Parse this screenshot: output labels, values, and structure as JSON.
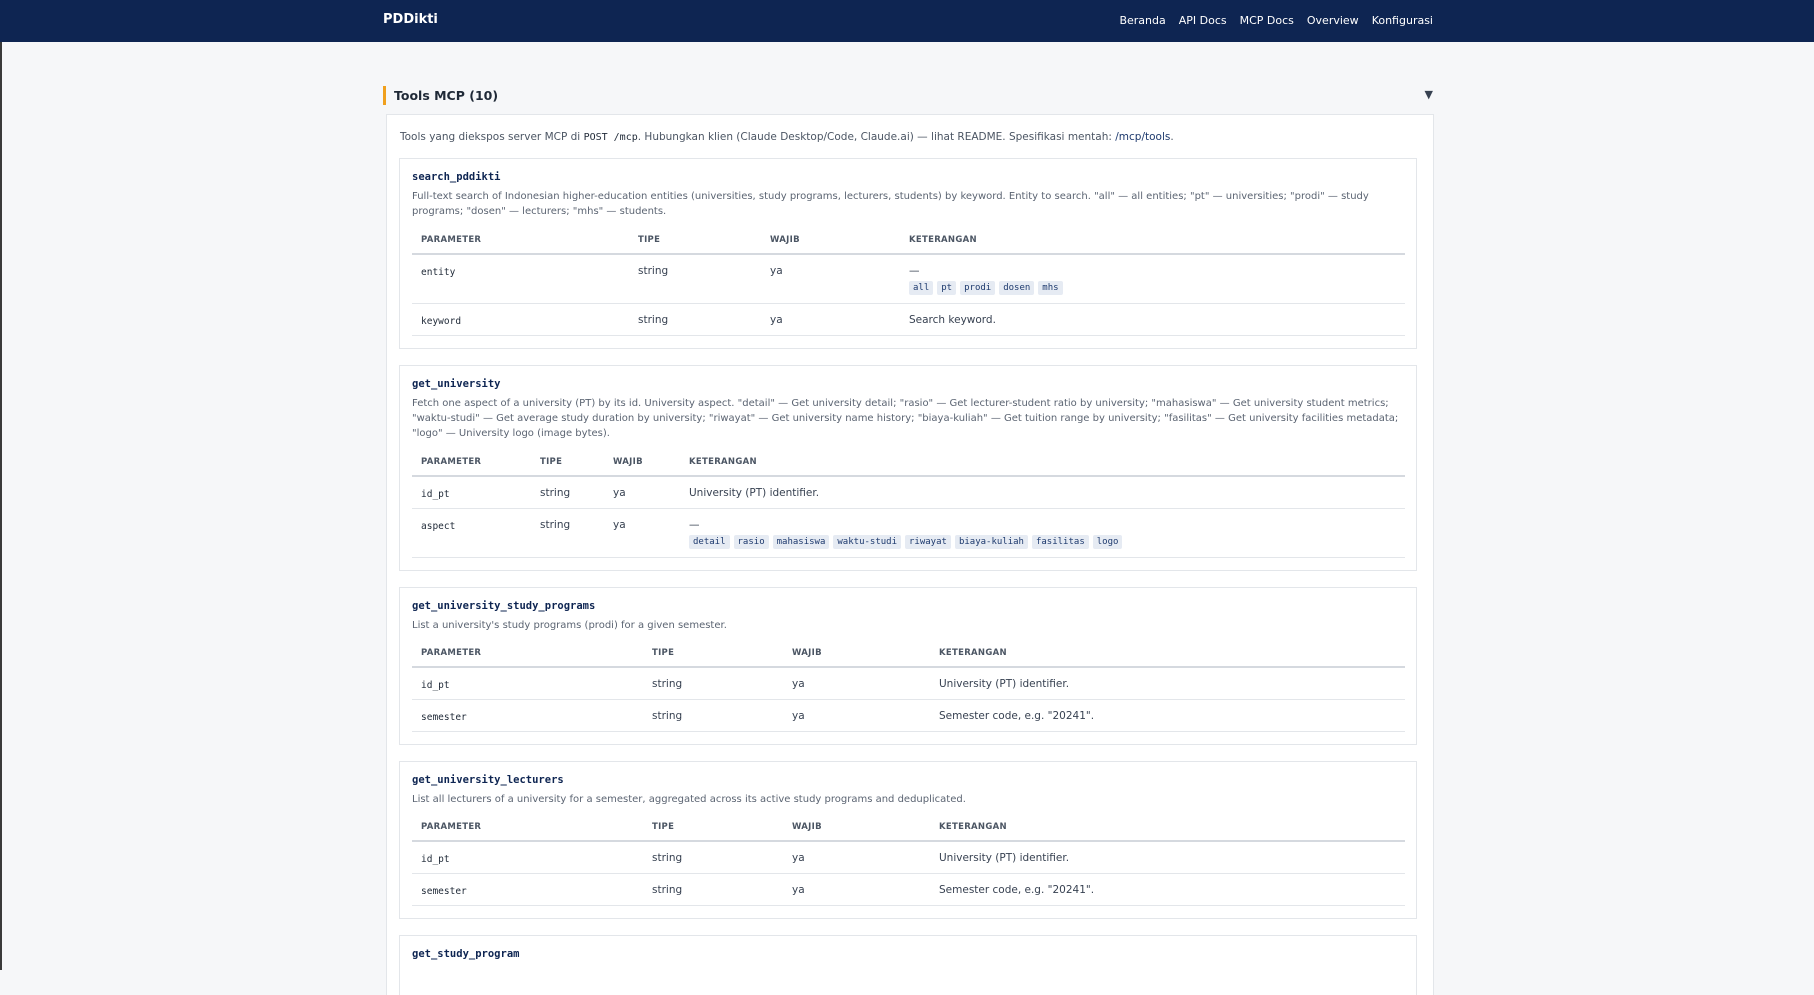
{
  "nav": {
    "brand": "PDDikti",
    "links": [
      "Beranda",
      "API Docs",
      "MCP Docs",
      "Overview",
      "Konfigurasi"
    ]
  },
  "section": {
    "title": "Tools MCP (10)",
    "caret": "▼",
    "intro_prefix": "Tools yang diekspos server MCP di ",
    "intro_code": "POST /mcp",
    "intro_middle": ". Hubungkan klien (Claude Desktop/Code, Claude.ai) — lihat README. Spesifikasi mentah: ",
    "intro_link": "/mcp/tools",
    "intro_suffix": "."
  },
  "table_headers": {
    "parameter": "PARAMETER",
    "type": "TIPE",
    "required": "WAJIB",
    "description": "KETERANGAN"
  },
  "tools": [
    {
      "name": "search_pddikti",
      "description": "Full-text search of Indonesian higher-education entities (universities, study programs, lecturers, students) by keyword. Entity to search. \"all\" — all entities; \"pt\" — universities; \"prodi\" — study programs; \"dosen\" — lecturers; \"mhs\" — students.",
      "params": [
        {
          "name": "entity",
          "type": "string",
          "required": "ya",
          "desc": "—",
          "enum": [
            "all",
            "pt",
            "prodi",
            "dosen",
            "mhs"
          ]
        },
        {
          "name": "keyword",
          "type": "string",
          "required": "ya",
          "desc": "Search keyword."
        }
      ]
    },
    {
      "name": "get_university",
      "description": "Fetch one aspect of a university (PT) by its id. University aspect. \"detail\" — Get university detail; \"rasio\" — Get lecturer-student ratio by university; \"mahasiswa\" — Get university student metrics; \"waktu-studi\" — Get average study duration by university; \"riwayat\" — Get university name history; \"biaya-kuliah\" — Get tuition range by university; \"fasilitas\" — Get university facilities metadata; \"logo\" — University logo (image bytes).",
      "params": [
        {
          "name": "id_pt",
          "type": "string",
          "required": "ya",
          "desc": "University (PT) identifier."
        },
        {
          "name": "aspect",
          "type": "string",
          "required": "ya",
          "desc": "—",
          "enum": [
            "detail",
            "rasio",
            "mahasiswa",
            "waktu-studi",
            "riwayat",
            "biaya-kuliah",
            "fasilitas",
            "logo"
          ]
        }
      ]
    },
    {
      "name": "get_university_study_programs",
      "description": "List a university's study programs (prodi) for a given semester.",
      "params": [
        {
          "name": "id_pt",
          "type": "string",
          "required": "ya",
          "desc": "University (PT) identifier."
        },
        {
          "name": "semester",
          "type": "string",
          "required": "ya",
          "desc": "Semester code, e.g. \"20241\"."
        }
      ]
    },
    {
      "name": "get_university_lecturers",
      "description": "List all lecturers of a university for a semester, aggregated across its active study programs and deduplicated.",
      "params": [
        {
          "name": "id_pt",
          "type": "string",
          "required": "ya",
          "desc": "University (PT) identifier."
        },
        {
          "name": "semester",
          "type": "string",
          "required": "ya",
          "desc": "Semester code, e.g. \"20241\"."
        }
      ]
    },
    {
      "name": "get_study_program"
    }
  ]
}
